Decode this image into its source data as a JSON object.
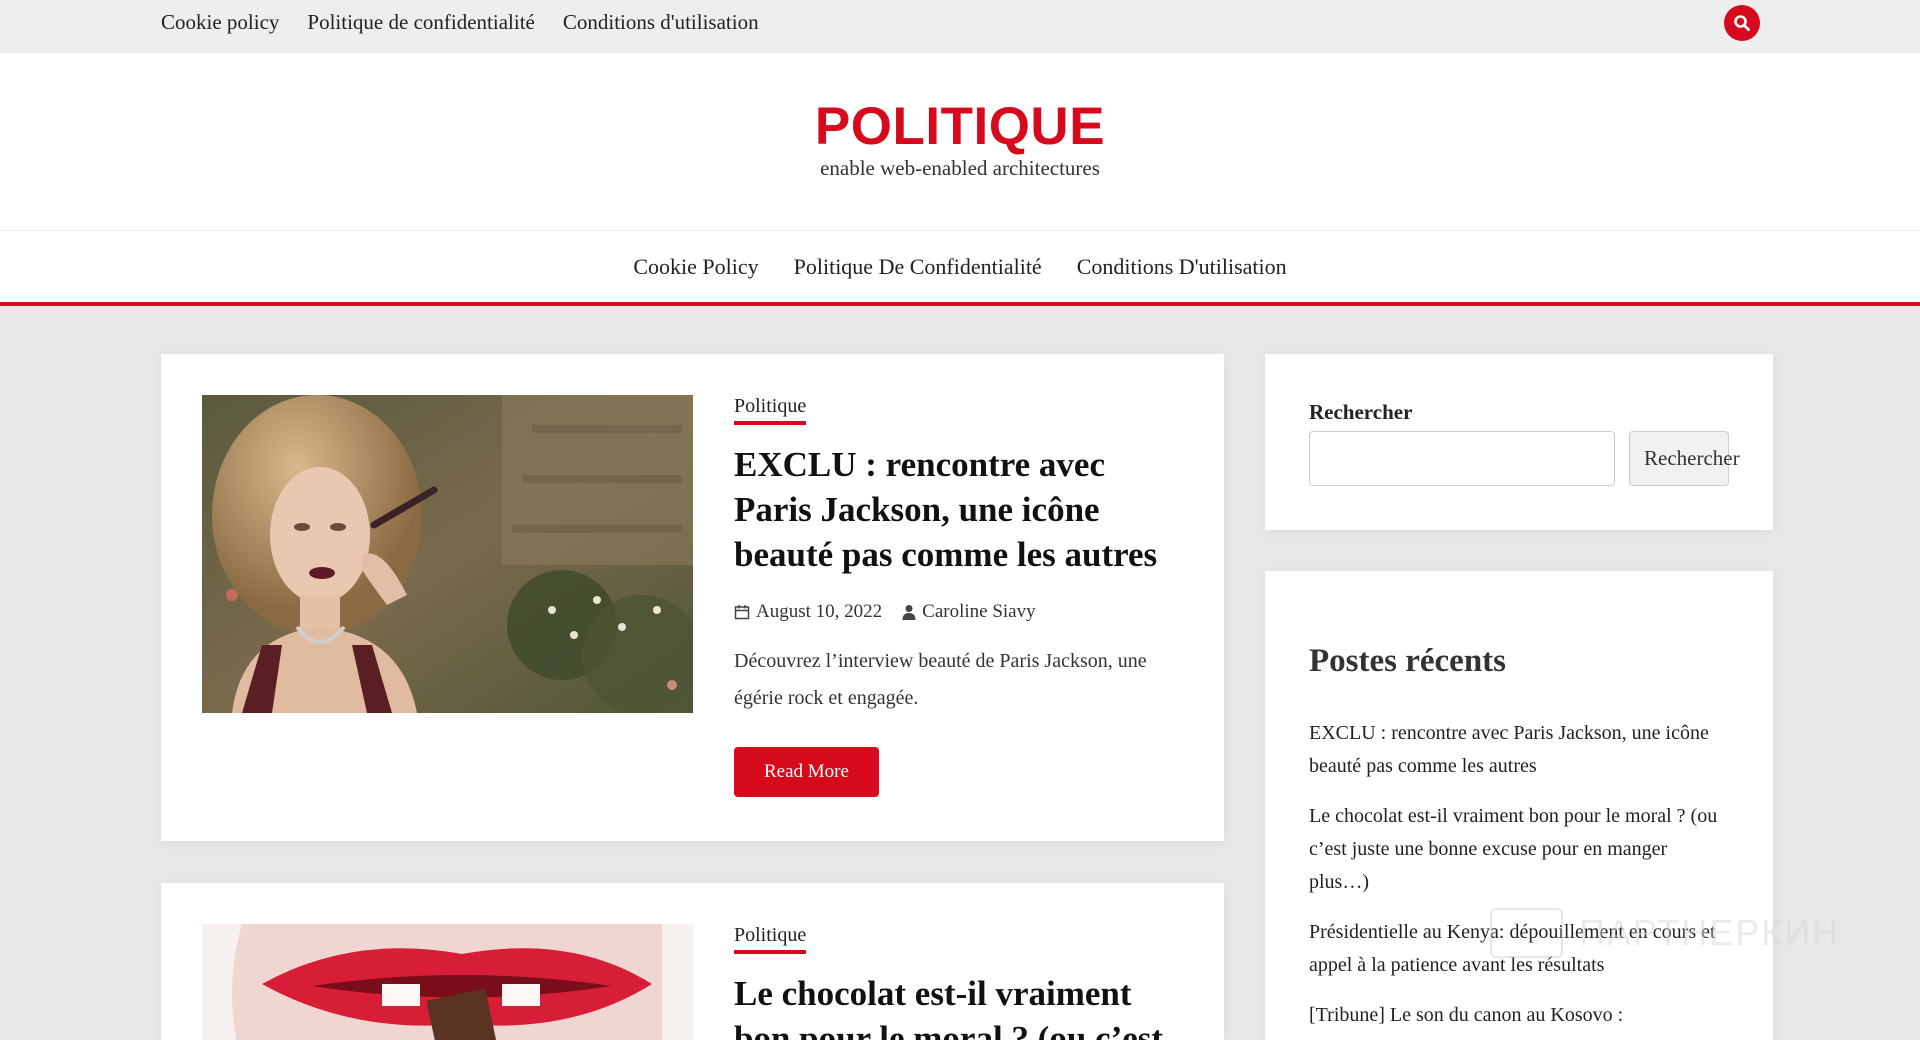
{
  "topbar": {
    "links": [
      "Cookie policy",
      "Politique de confidentialité",
      "Conditions d'utilisation"
    ],
    "search_icon": "search-icon"
  },
  "header": {
    "title": "POLITIQUE",
    "tagline": "enable web-enabled architectures"
  },
  "nav": {
    "links": [
      "Cookie Policy",
      "Politique De Confidentialité",
      "Conditions D'utilisation"
    ]
  },
  "posts": [
    {
      "category": "Politique",
      "title": "EXCLU : rencontre avec Paris Jackson, une icône beauté pas comme les autres",
      "date": "August 10, 2022",
      "author": "Caroline Siavy",
      "excerpt": "Découvrez l’interview beauté de Paris Jackson, une égérie rock et engagée.",
      "read_more": "Read More"
    },
    {
      "category": "Politique",
      "title": "Le chocolat est-il vraiment bon pour le moral ? (ou c’est"
    }
  ],
  "sidebar": {
    "search": {
      "label": "Rechercher",
      "button": "Rechercher",
      "placeholder": ""
    },
    "recent": {
      "title": "Postes récents",
      "items": [
        "EXCLU : rencontre avec Paris Jackson, une icône beauté pas comme les autres",
        "Le chocolat est-il vraiment bon pour le moral ? (ou c’est juste une bonne excuse pour en manger plus…)",
        "Présidentielle au Kenya: dépouillement en cours et appel à la patience avant les résultats",
        "[Tribune] Le son du canon au Kosovo :"
      ]
    }
  },
  "watermark": {
    "text": "ПАРТНЕРКИН"
  },
  "colors": {
    "accent": "#d60a1c",
    "background": "#e6e9e8"
  }
}
